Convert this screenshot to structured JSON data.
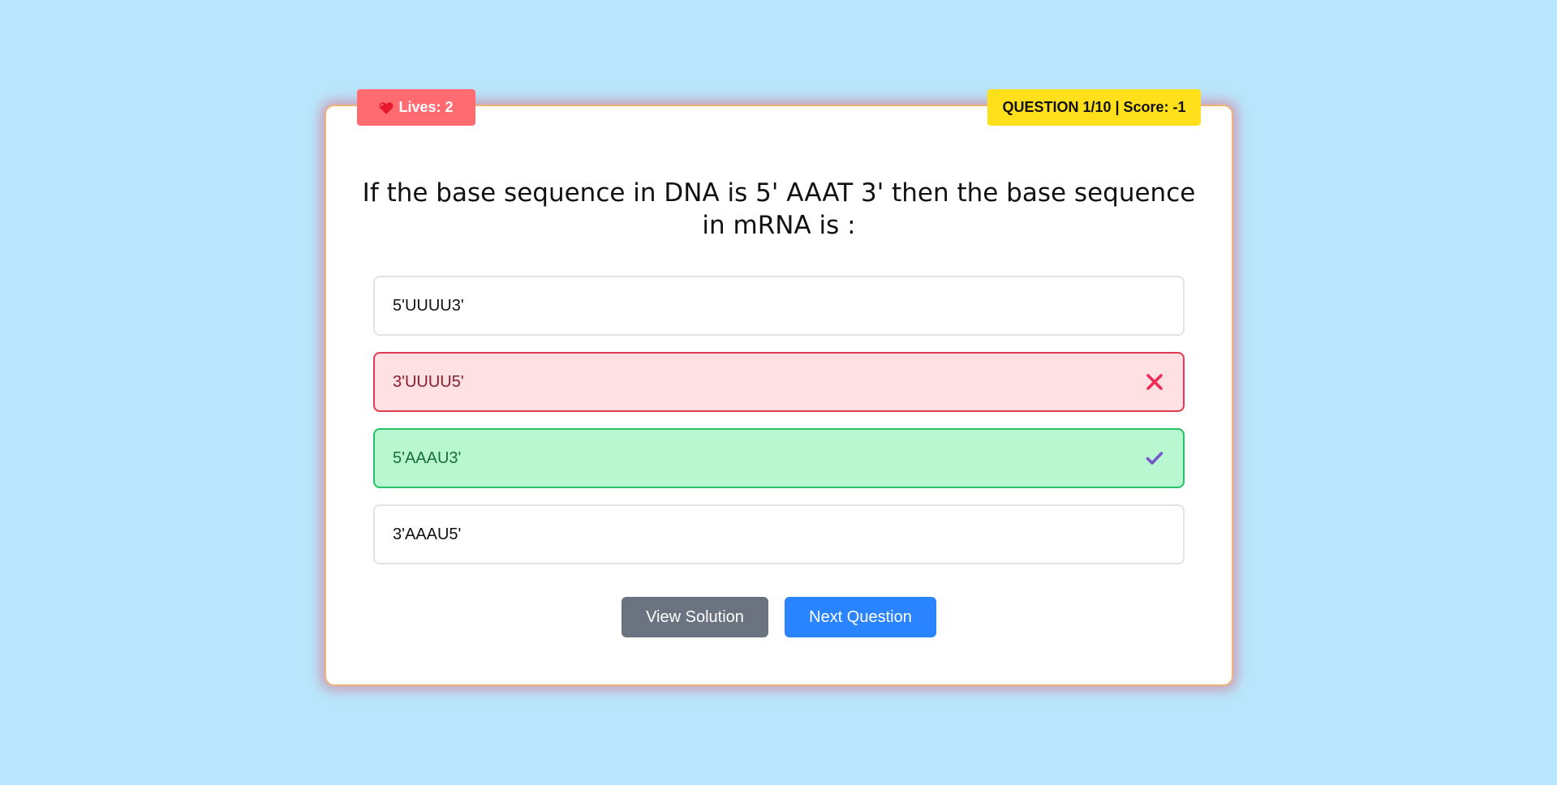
{
  "header": {
    "lives_label": "Lives: 2",
    "score_label": "QUESTION 1/10 | Score: -1"
  },
  "question": {
    "text": "If the base sequence in DNA is 5' AAAT 3' then the base sequence in mRNA is :"
  },
  "options": [
    {
      "label": "5'UUUU3'",
      "state": "default"
    },
    {
      "label": "3'UUUU5'",
      "state": "wrong"
    },
    {
      "label": "5'AAAU3'",
      "state": "correct"
    },
    {
      "label": "3'AAAU5'",
      "state": "default"
    }
  ],
  "actions": {
    "view_solution_label": "View Solution",
    "next_question_label": "Next Question"
  },
  "icons": {
    "lives": "heart-icon",
    "wrong": "close-icon",
    "correct": "check-icon"
  },
  "colors": {
    "background": "#b9e6fc",
    "lives_badge": "#ff6b70",
    "score_badge": "#ffe01b",
    "wrong_bg": "#ffe1e3",
    "wrong_border": "#e53951",
    "correct_bg": "#b9f7d0",
    "correct_border": "#27c265",
    "solution_button": "#6b7381",
    "next_button": "#2b84ff"
  }
}
